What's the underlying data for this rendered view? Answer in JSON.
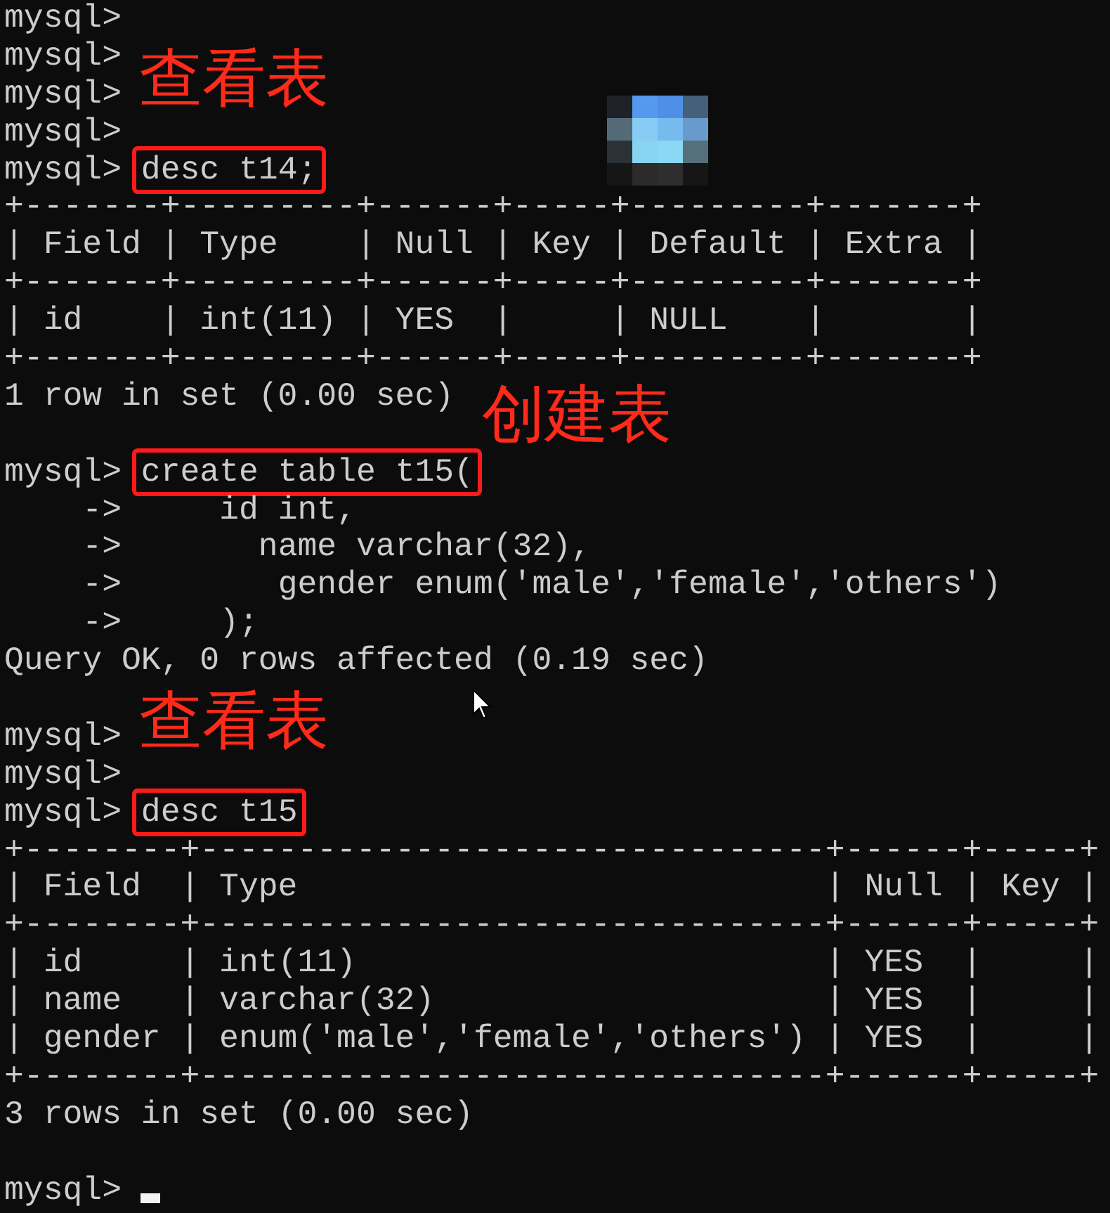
{
  "terminal": {
    "lines": [
      {
        "kind": "prompt",
        "prompt": "mysql>"
      },
      {
        "kind": "prompt",
        "prompt": "mysql>",
        "annotation": "查看表"
      },
      {
        "kind": "prompt",
        "prompt": "mysql>"
      },
      {
        "kind": "prompt",
        "prompt": "mysql>"
      },
      {
        "kind": "prompt",
        "prompt": "mysql>",
        "command": "desc t14;",
        "highlighted": true
      },
      {
        "kind": "output",
        "text": "+-------+---------+------+-----+---------+-------+"
      },
      {
        "kind": "output",
        "text": "| Field | Type    | Null | Key | Default | Extra |"
      },
      {
        "kind": "output",
        "text": "+-------+---------+------+-----+---------+-------+"
      },
      {
        "kind": "output",
        "text": "| id    | int(11) | YES  |     | NULL    |       |"
      },
      {
        "kind": "output",
        "text": "+-------+---------+------+-----+---------+-------+",
        "annotation": "创建表"
      },
      {
        "kind": "output",
        "text": "1 row in set (0.00 sec)"
      },
      {
        "kind": "blank"
      },
      {
        "kind": "prompt",
        "prompt": "mysql>",
        "command": "create table t15(",
        "highlighted": true
      },
      {
        "kind": "continuation",
        "prompt": "->",
        "command": "     id int,"
      },
      {
        "kind": "continuation",
        "prompt": "->",
        "command": "       name varchar(32),"
      },
      {
        "kind": "continuation",
        "prompt": "->",
        "command": "        gender enum('male','female','others')"
      },
      {
        "kind": "continuation",
        "prompt": "->",
        "command": "     );"
      },
      {
        "kind": "output",
        "text": "Query OK, 0 rows affected (0.19 sec)"
      },
      {
        "kind": "blank",
        "annotation": "查看表"
      },
      {
        "kind": "prompt",
        "prompt": "mysql>"
      },
      {
        "kind": "prompt",
        "prompt": "mysql>"
      },
      {
        "kind": "prompt",
        "prompt": "mysql>",
        "command": "desc t15",
        "highlighted": true
      },
      {
        "kind": "output",
        "text": "+--------+--------------------------------+------+-----+"
      },
      {
        "kind": "output",
        "text": "| Field  | Type                           | Null | Key |"
      },
      {
        "kind": "output",
        "text": "+--------+--------------------------------+------+-----+"
      },
      {
        "kind": "output",
        "text": "| id     | int(11)                        | YES  |     |"
      },
      {
        "kind": "output",
        "text": "| name   | varchar(32)                    | YES  |     |"
      },
      {
        "kind": "output",
        "text": "| gender | enum('male','female','others') | YES  |     |"
      },
      {
        "kind": "output",
        "text": "+--------+--------------------------------+------+-----+"
      },
      {
        "kind": "output",
        "text": "3 rows in set (0.00 sec)"
      },
      {
        "kind": "blank"
      },
      {
        "kind": "prompt",
        "prompt": "mysql>",
        "cursor": true
      }
    ]
  }
}
